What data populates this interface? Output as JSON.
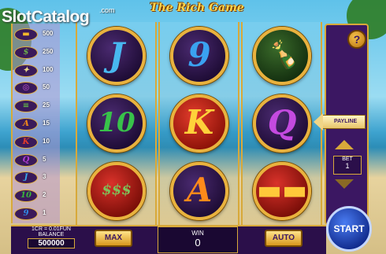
{
  "watermark": {
    "slot": "Slot",
    "catalog": "Catalog",
    "com": ".com"
  },
  "title": "The Rich Game",
  "paytable": [
    {
      "icon": "gold-bars-icon",
      "glyph": "▬",
      "color": "#f5b82a",
      "value": "500"
    },
    {
      "icon": "money-stack-icon",
      "glyph": "$",
      "color": "#6bb04a",
      "value": "250"
    },
    {
      "icon": "champagne-icon",
      "glyph": "✦",
      "color": "#e6d38a",
      "value": "100"
    },
    {
      "icon": "ring-icon",
      "glyph": "◎",
      "color": "#c95ad8",
      "value": "50"
    },
    {
      "icon": "cash-icon",
      "glyph": "≡",
      "color": "#5fa84a",
      "value": "25"
    },
    {
      "icon": "a-icon",
      "glyph": "A",
      "color": "#f28a1a",
      "value": "15"
    },
    {
      "icon": "k-icon",
      "glyph": "K",
      "color": "#e23c2c",
      "value": "10"
    },
    {
      "icon": "q-icon",
      "glyph": "Q",
      "color": "#b43cd8",
      "value": "5"
    },
    {
      "icon": "j-icon",
      "glyph": "J",
      "color": "#3aa6e8",
      "value": "3"
    },
    {
      "icon": "ten-icon",
      "glyph": "10",
      "color": "#3ab83a",
      "value": "2"
    },
    {
      "icon": "nine-icon",
      "glyph": "9",
      "color": "#2f8ae6",
      "value": "1"
    }
  ],
  "reels": [
    [
      {
        "icon": "j-symbol",
        "text": "J",
        "color": "#48b8f0",
        "style": ""
      },
      {
        "icon": "ten-symbol",
        "text": "10",
        "color": "#38c24a",
        "style": ""
      },
      {
        "icon": "money-stack-symbol",
        "text": "$$$",
        "color": "#7fc25a",
        "style": "gold"
      }
    ],
    [
      {
        "icon": "nine-symbol",
        "text": "9",
        "color": "#3aa2f0",
        "style": ""
      },
      {
        "icon": "k-symbol",
        "text": "K",
        "color": "#ffd23a",
        "style": "red"
      },
      {
        "icon": "a-symbol",
        "text": "A",
        "color": "#ff8a1a",
        "style": ""
      }
    ],
    [
      {
        "icon": "champagne-symbol",
        "text": "🍾",
        "color": "#f0e0a0",
        "style": "dark"
      },
      {
        "icon": "q-symbol",
        "text": "Q",
        "color": "#c44ae0",
        "style": ""
      },
      {
        "icon": "gold-bars-symbol",
        "text": "▬▬",
        "color": "#ffc93a",
        "style": "gold"
      }
    ]
  ],
  "controls": {
    "help": "?",
    "payline": "PAYLINE",
    "bet_label": "BET",
    "bet_value": "1",
    "cr_rate": "1CR = 0.01FUN",
    "balance_label": "BALANCE",
    "balance_value": "500000",
    "max": "MAX",
    "win_label": "WIN",
    "win_value": "0",
    "auto": "AUTO",
    "start": "START"
  }
}
